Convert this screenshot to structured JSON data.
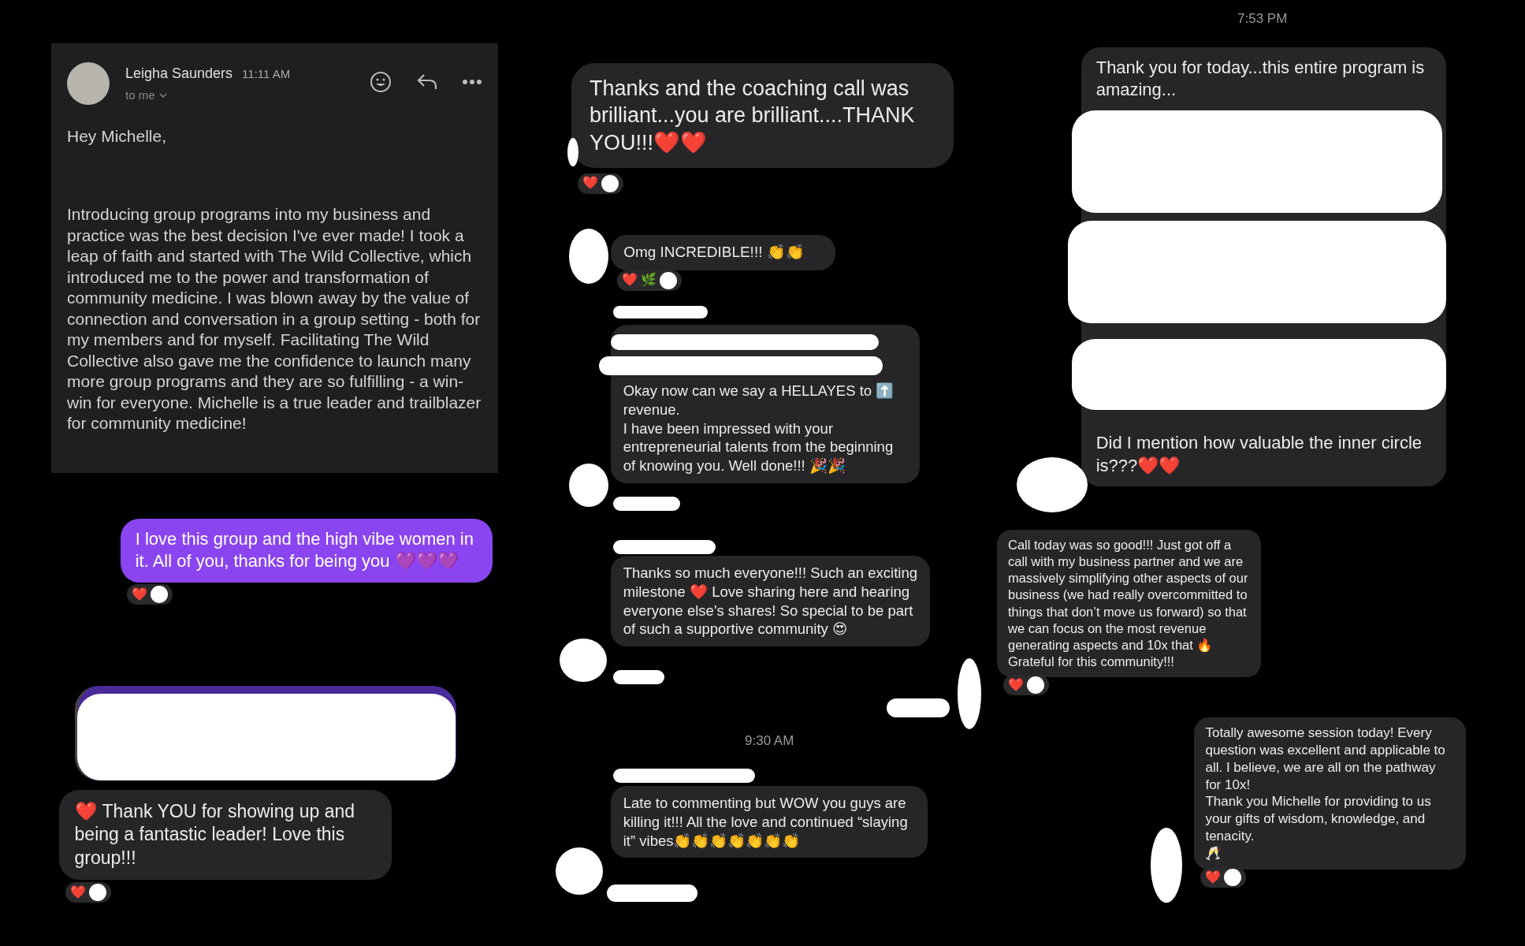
{
  "email": {
    "sender": "Leigha Saunders",
    "time": "11:11 AM",
    "recipient": "to me",
    "greeting": "Hey Michelle,",
    "body": "Introducing group programs into my business and practice was the best decision I've ever made! I took a leap of faith and started with The Wild Collective, which introduced me to the power and transformation of community medicine. I was blown away by the value of connection and conversation in a group setting - both for my members and for myself. Facilitating The Wild Collective also gave me the confidence to launch many more group programs and they are so fulfilling - a win-win for everyone. Michelle is a true leader and trailblazer for community medicine!"
  },
  "timestamps": [
    "7:53 PM",
    "9:30 AM"
  ],
  "messages": [
    {
      "kind": "sent",
      "paragraphs": [
        "I love this group and the high vibe women in it. All of you, thanks for being you 💜💜💜"
      ],
      "reactions": [
        "❤️"
      ]
    },
    {
      "kind": "received",
      "paragraphs": [
        "❤️ Thank YOU for showing up and being a fantastic leader! Love this group!!!"
      ],
      "reactions": [
        "❤️"
      ]
    },
    {
      "kind": "received",
      "paragraphs": [
        "Thanks and the coaching call was brilliant...you are brilliant....THANK YOU!!!❤️❤️"
      ],
      "reactions": [
        "❤️"
      ]
    },
    {
      "kind": "received",
      "paragraphs": [
        "Omg INCREDIBLE!!! 👏👏"
      ],
      "reactions": [
        "❤️",
        "🌿"
      ]
    },
    {
      "kind": "received",
      "paragraphs": [
        "Okay now can we say a HELLAYES to ⬆️ revenue.",
        "I have been impressed with your entrepreneurial talents from the beginning of knowing you.  Well done!!! 🎉🎉"
      ]
    },
    {
      "kind": "received",
      "paragraphs": [
        "Thanks so much everyone!!! Such an exciting milestone ❤️ Love sharing here and hearing everyone else's shares! So special to be part of such a supportive community 😍"
      ]
    },
    {
      "kind": "received",
      "paragraphs": [
        "Late to commenting but WOW you guys are killing it!!!  All the love and continued “slaying it” vibes👏👏👏👏👏👏👏"
      ]
    },
    {
      "kind": "received",
      "paragraphs": [
        "Thank you for today...this entire program is amazing...",
        "Did I mention how valuable the inner circle is???❤️❤️"
      ]
    },
    {
      "kind": "received",
      "paragraphs": [
        "Call today was so good!!! Just got off a call with my business partner and we are massively simplifying other aspects of our business (we had really overcommitted to things that don’t move us forward) so that we can focus on the most revenue generating aspects and 10x that 🔥 Grateful for this community!!!"
      ],
      "reactions": [
        "❤️"
      ]
    },
    {
      "kind": "received",
      "paragraphs": [
        "Totally awesome session today!  Every question was excellent and applicable to all.  I believe, we are all on the pathway for 10x!",
        "Thank you Michelle for providing to us your gifts of wisdom, knowledge, and tenacity.",
        "🥂"
      ],
      "reactions": [
        "❤️"
      ]
    }
  ]
}
